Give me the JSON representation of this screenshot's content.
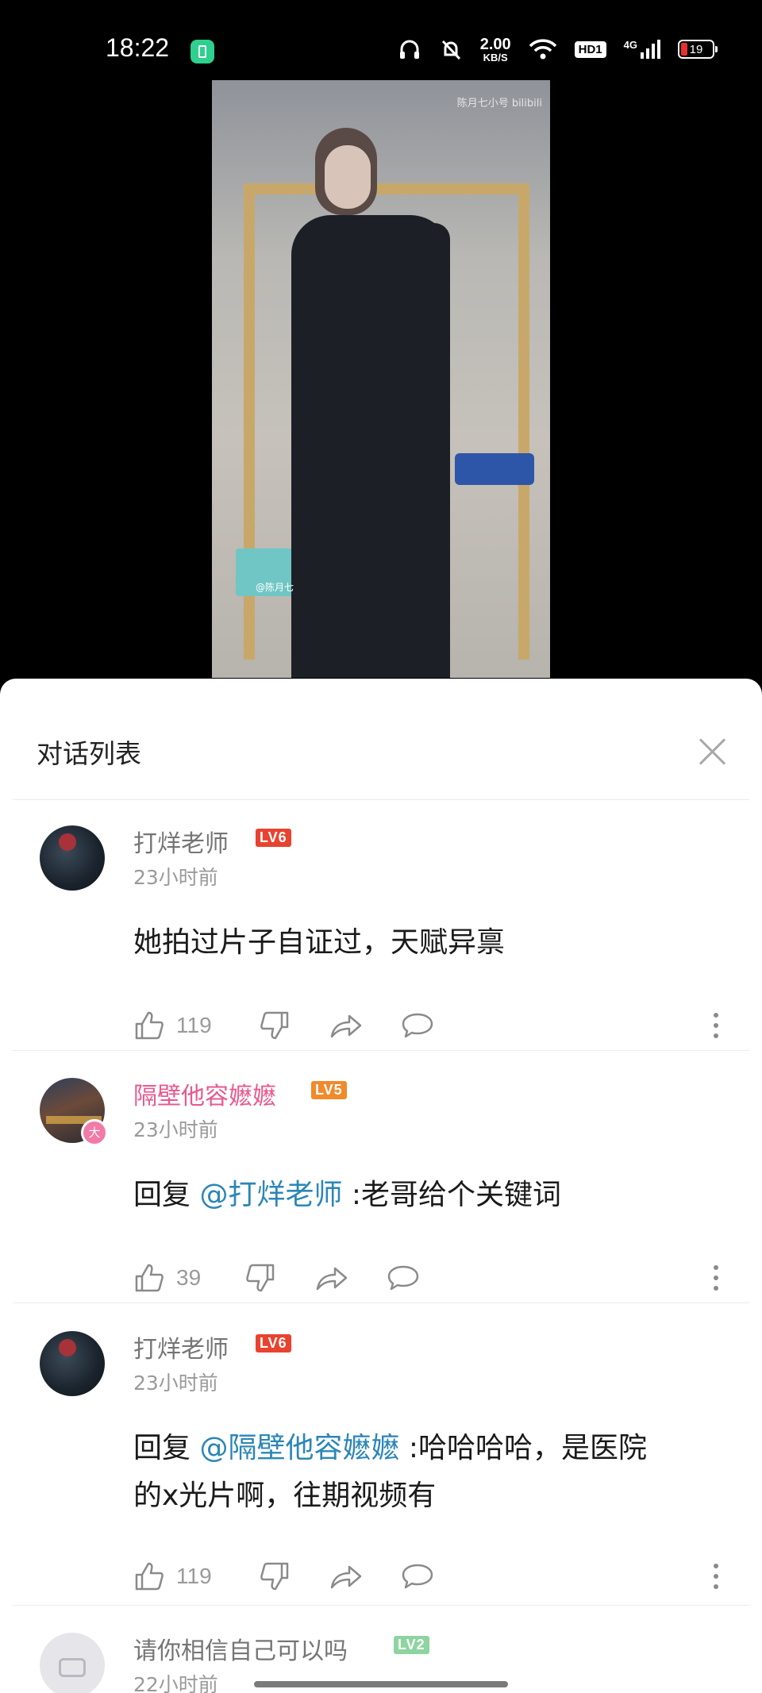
{
  "status_bar": {
    "time": "18:22",
    "net_speed_value": "2.00",
    "net_speed_unit": "KB/S",
    "hd_label": "HD1",
    "signal_label": "4G",
    "battery_level": "19"
  },
  "video": {
    "watermark": "陈月七小号 bilibili",
    "tag": "@陈月七"
  },
  "sheet": {
    "title": "对话列表"
  },
  "comments": [
    {
      "user": "打烊老师",
      "level": "LV6",
      "time": "23小时前",
      "text_lines": [
        "她拍过片子自证过，天赋异禀"
      ],
      "likes": "119"
    },
    {
      "user": "隔壁他容嬷嬷",
      "level": "LV5",
      "badge": "大",
      "time": "23小时前",
      "reply_prefix": "回复 ",
      "mention": "@打烊老师",
      "text": " :老哥给个关键词",
      "likes": "39"
    },
    {
      "user": "打烊老师",
      "level": "LV6",
      "time": "23小时前",
      "reply_prefix": "回复 ",
      "mention": "@隔壁他容嬷嬷",
      "text": " :哈哈哈哈，是医院",
      "text_line2": "的x光片啊，往期视频有",
      "likes": "119"
    },
    {
      "user": "请你相信自己可以吗",
      "level": "LV2",
      "time": "22小时前"
    }
  ],
  "colors": {
    "mention": "#2b86b7",
    "vip_name": "#e8598d",
    "lv6": "#e8432f",
    "lv5": "#f08a2b",
    "lv2": "#8dd4a0"
  }
}
